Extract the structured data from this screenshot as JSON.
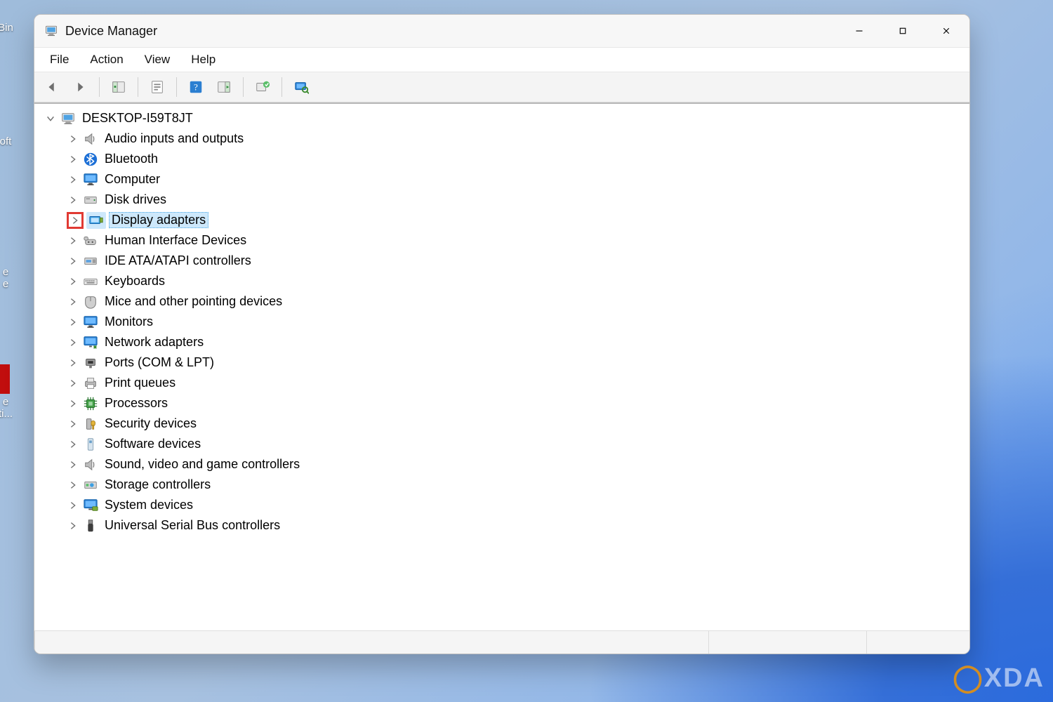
{
  "window": {
    "title": "Device Manager",
    "menus": [
      "File",
      "Action",
      "View",
      "Help"
    ]
  },
  "desktop_icons": {
    "recycle": "Bin",
    "second": "oft",
    "third": "e\ne",
    "fourth": "e\nti..."
  },
  "toolbar_buttons": [
    {
      "name": "back",
      "tip": "Back"
    },
    {
      "name": "forward",
      "tip": "Forward"
    },
    {
      "name": "show-hide-tree",
      "tip": "Show/Hide Console Tree"
    },
    {
      "name": "properties",
      "tip": "Properties"
    },
    {
      "name": "help",
      "tip": "Help"
    },
    {
      "name": "action-panel",
      "tip": "Action Panel"
    },
    {
      "name": "update-driver",
      "tip": "Update Driver"
    },
    {
      "name": "scan-hardware",
      "tip": "Scan for hardware changes"
    }
  ],
  "tree": {
    "root": {
      "label": "DESKTOP-I59T8JT",
      "expanded": true
    },
    "categories": [
      {
        "icon": "speaker",
        "label": "Audio inputs and outputs"
      },
      {
        "icon": "bluetooth",
        "label": "Bluetooth"
      },
      {
        "icon": "monitor",
        "label": "Computer"
      },
      {
        "icon": "disk",
        "label": "Disk drives"
      },
      {
        "icon": "display",
        "label": "Display adapters",
        "selected": true,
        "highlight_chevron": true
      },
      {
        "icon": "hid",
        "label": "Human Interface Devices"
      },
      {
        "icon": "ide",
        "label": "IDE ATA/ATAPI controllers"
      },
      {
        "icon": "keyboard",
        "label": "Keyboards"
      },
      {
        "icon": "mouse",
        "label": "Mice and other pointing devices"
      },
      {
        "icon": "monitor",
        "label": "Monitors"
      },
      {
        "icon": "network",
        "label": "Network adapters"
      },
      {
        "icon": "port",
        "label": "Ports (COM & LPT)"
      },
      {
        "icon": "printer",
        "label": "Print queues"
      },
      {
        "icon": "cpu",
        "label": "Processors"
      },
      {
        "icon": "security",
        "label": "Security devices"
      },
      {
        "icon": "software",
        "label": "Software devices"
      },
      {
        "icon": "speaker",
        "label": "Sound, video and game controllers"
      },
      {
        "icon": "storage",
        "label": "Storage controllers"
      },
      {
        "icon": "system",
        "label": "System devices"
      },
      {
        "icon": "usb",
        "label": "Universal Serial Bus controllers"
      }
    ]
  },
  "watermark": "XDA"
}
